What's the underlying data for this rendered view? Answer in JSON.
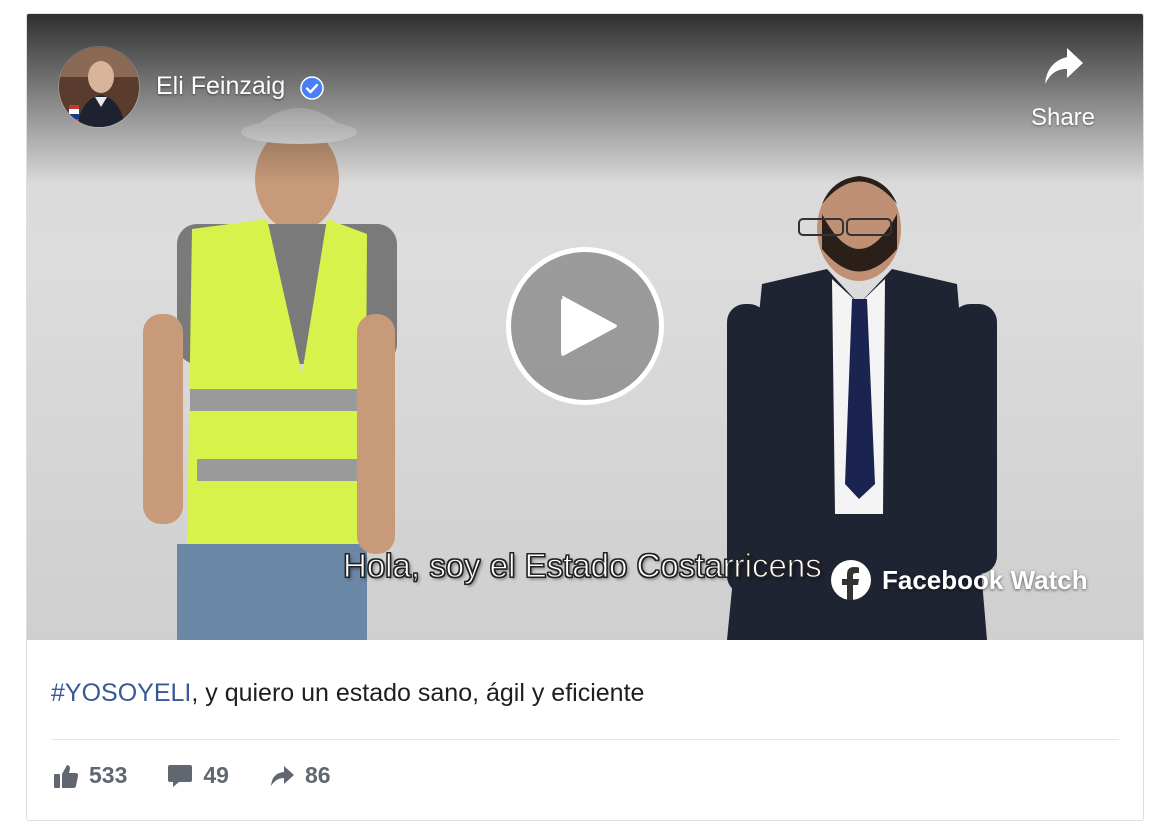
{
  "post": {
    "page_name": "Eli Feinzaig",
    "verified": true,
    "share_label": "Share",
    "subtitle": "Hola, soy el Estado Costarricens",
    "watch_label": "Facebook Watch",
    "caption_hashtag": "#YOSOYELI",
    "caption_text": ", y quiero un estado sano, ágil y eficiente"
  },
  "stats": {
    "likes": "533",
    "comments": "49",
    "shares": "86"
  },
  "colors": {
    "link": "#385898",
    "verified": "#4a7ef5",
    "stat_gray": "#606770"
  },
  "icons": [
    "verified-badge-icon",
    "share-arrow-icon",
    "play-icon",
    "facebook-logo-icon",
    "thumbs-up-icon",
    "comment-icon",
    "share-icon"
  ]
}
